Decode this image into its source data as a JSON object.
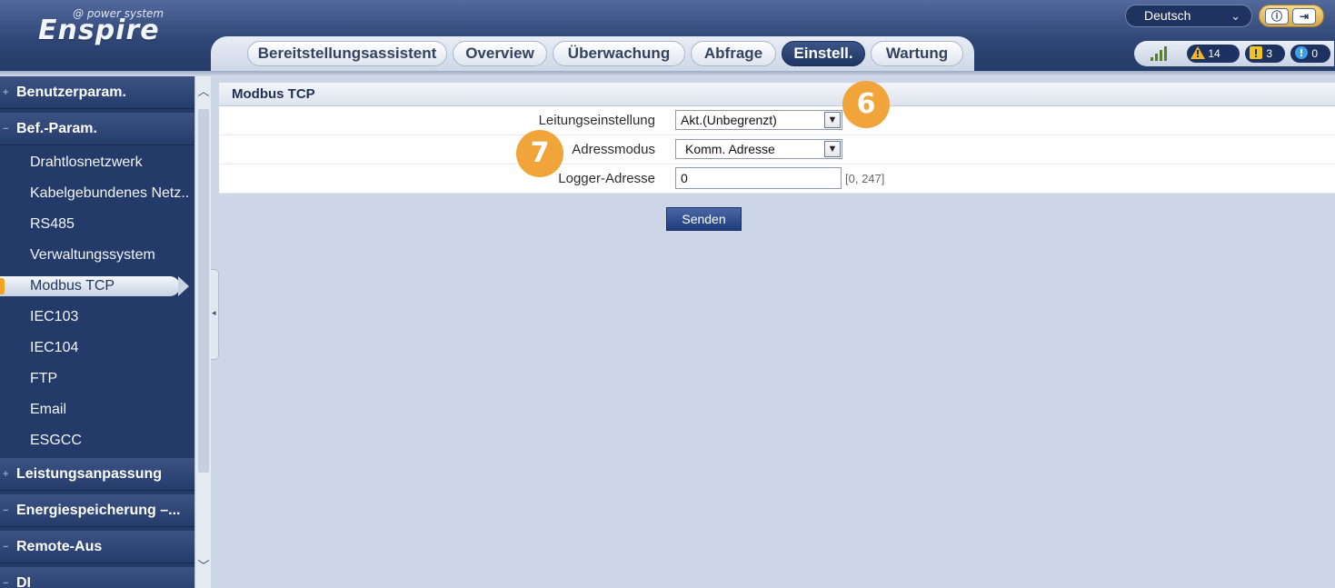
{
  "header": {
    "logo_tag": "@ power system",
    "logo_word": "Enspire",
    "language": "Deutsch",
    "tabs": [
      {
        "label": "Bereitstellungsassistent"
      },
      {
        "label": "Overview"
      },
      {
        "label": "Überwachung"
      },
      {
        "label": "Abfrage"
      },
      {
        "label": "Einstell."
      },
      {
        "label": "Wartung"
      }
    ],
    "active_tab": "Einstell.",
    "alarms": {
      "major": "14",
      "minor": "3",
      "info": "0"
    },
    "colors": {
      "header": "#2f4676",
      "major_alarm": "#f2b820",
      "minor_alarm": "#f2c318",
      "info_alarm": "#3da0e6"
    }
  },
  "sidebar": {
    "groups": [
      {
        "label": "Benutzerparam.",
        "marker": "+"
      },
      {
        "label": "Bef.-Param.",
        "marker": "−"
      },
      {
        "label": "Leistungsanpassung",
        "marker": "+"
      },
      {
        "label": "Energiespeicherung –...",
        "marker": "−"
      },
      {
        "label": "Remote-Aus",
        "marker": "−"
      },
      {
        "label": "DI",
        "marker": "−"
      }
    ],
    "items": [
      {
        "label": "Drahtlosnetzwerk"
      },
      {
        "label": "Kabelgebundenes Netz.."
      },
      {
        "label": "RS485"
      },
      {
        "label": "Verwaltungssystem"
      },
      {
        "label": "Modbus TCP"
      },
      {
        "label": "IEC103"
      },
      {
        "label": "IEC104"
      },
      {
        "label": "FTP"
      },
      {
        "label": "Email"
      },
      {
        "label": "ESGCC"
      }
    ],
    "active_item": "Modbus TCP"
  },
  "main": {
    "title": "Modbus TCP",
    "fields": {
      "connection_label": "Leitungseinstellung",
      "connection_value": "Akt.(Unbegrenzt)",
      "address_mode_label": "Adressmodus",
      "address_mode_value": "Komm. Adresse",
      "logger_label": "Logger-Adresse",
      "logger_value": "0",
      "logger_range": "[0, 247]"
    },
    "send_label": "Senden"
  },
  "callouts": {
    "c6": "6",
    "c7": "7"
  }
}
